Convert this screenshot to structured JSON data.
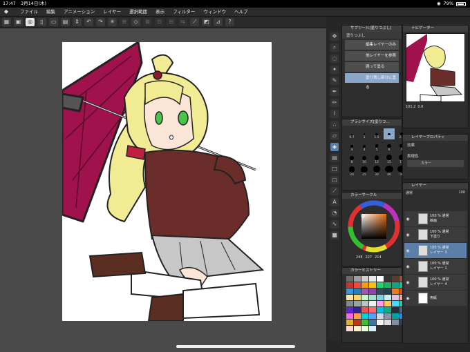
{
  "status": {
    "time": "17:47",
    "date": "3月14日(木)",
    "battery": "79%"
  },
  "menu": [
    "ファイル",
    "編集",
    "アニメーション",
    "レイヤー",
    "選択範囲",
    "表示",
    "フィルター",
    "ウィンドウ",
    "ヘルプ"
  ],
  "subtool": {
    "title": "サブツール[塗りつぶし]",
    "tab": "塗りつぶし",
    "items": [
      "編集レイヤーのみ参照",
      "他レイヤーを参照",
      "囲って塗る",
      "塗り残し部分に塗る"
    ]
  },
  "navigator": {
    "title": "ナビゲーター",
    "zoom": "101.2",
    "angle": "0.0"
  },
  "brushsize": {
    "title": "ブラシサイズ[塗りつ...",
    "values": [
      "0.7",
      "1",
      "1.5",
      "2",
      "2.5",
      "3",
      "4",
      "5",
      "6",
      "7",
      "8",
      "10",
      "12",
      "15",
      "17",
      "20",
      "25",
      "30",
      "40",
      "50"
    ]
  },
  "layerprop": {
    "title": "レイヤープロパティ",
    "effect": "効果",
    "expression_color": "表現色",
    "color_mode": "カラー"
  },
  "colorcircle": {
    "title": "カラーサークル",
    "values": [
      "248",
      "227",
      "214"
    ]
  },
  "colorhistory": {
    "title": "カラーヒストリー"
  },
  "layers": {
    "title": "レイヤー",
    "blend": "通常",
    "opacity": "100",
    "items": [
      {
        "line1": "100 % 通常",
        "line2": "線画"
      },
      {
        "line1": "100 % 通常",
        "line2": "下塗り"
      },
      {
        "line1": "100 % 通常",
        "line2": "レイヤー 3"
      },
      {
        "line1": "100 % 通常",
        "line2": "レイヤー 1"
      },
      {
        "line1": "100 % 通常",
        "line2": "レイヤー 4"
      },
      {
        "line1": "",
        "line2": "用紙"
      }
    ]
  },
  "palette_colors": [
    "#6b6b6b",
    "#9d9d9d",
    "#cfcfcf",
    "#e8e8e8",
    "#ffffff",
    "#333333",
    "#5a3a2a",
    "#8b5a3c",
    "#c0392b",
    "#e74c3c",
    "#f39c12",
    "#f1c40f",
    "#2ecc71",
    "#27ae60",
    "#16a085",
    "#1abc9c",
    "#3498db",
    "#2980b9",
    "#9b59b6",
    "#8e44ad",
    "#34495e",
    "#2c3e50",
    "#e67e22",
    "#d35400",
    "#fde3a7",
    "#f5d76e",
    "#c8f7c5",
    "#a2ded0",
    "#81cfe0",
    "#c5eff7",
    "#dcc6e0",
    "#f1a9a0",
    "#7f8c8d",
    "#95a5a6",
    "#bdc3c7",
    "#ecf0f1",
    "#ff9ff3",
    "#feca57",
    "#48dbfb",
    "#1dd1a1",
    "#5f27cd",
    "#341f97",
    "#ee5253",
    "#ff6b6b",
    "#0abde3",
    "#10ac84",
    "#222f3e",
    "#576574",
    "#f368e0",
    "#ff9f43",
    "#00d2d3",
    "#54a0ff",
    "#c8d6e5",
    "#8395a7",
    "#01a3a4",
    "#2e86de",
    "#e1b12c",
    "#c23616",
    "#44bd32",
    "#40739e",
    "#f5f6fa",
    "#dcdde1",
    "#7f8fa6",
    "#353b48",
    "#ffd8d8",
    "#fff0c8",
    "#e8ffd8",
    "#d8f0ff"
  ]
}
